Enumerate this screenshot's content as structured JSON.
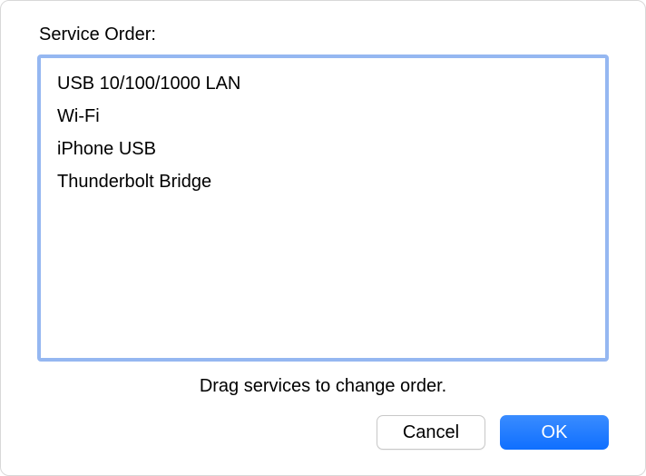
{
  "title": "Service Order:",
  "services": [
    "USB 10/100/1000 LAN",
    "Wi-Fi",
    "iPhone USB",
    "Thunderbolt Bridge"
  ],
  "hint": "Drag services to change order.",
  "buttons": {
    "cancel": "Cancel",
    "ok": "OK"
  }
}
